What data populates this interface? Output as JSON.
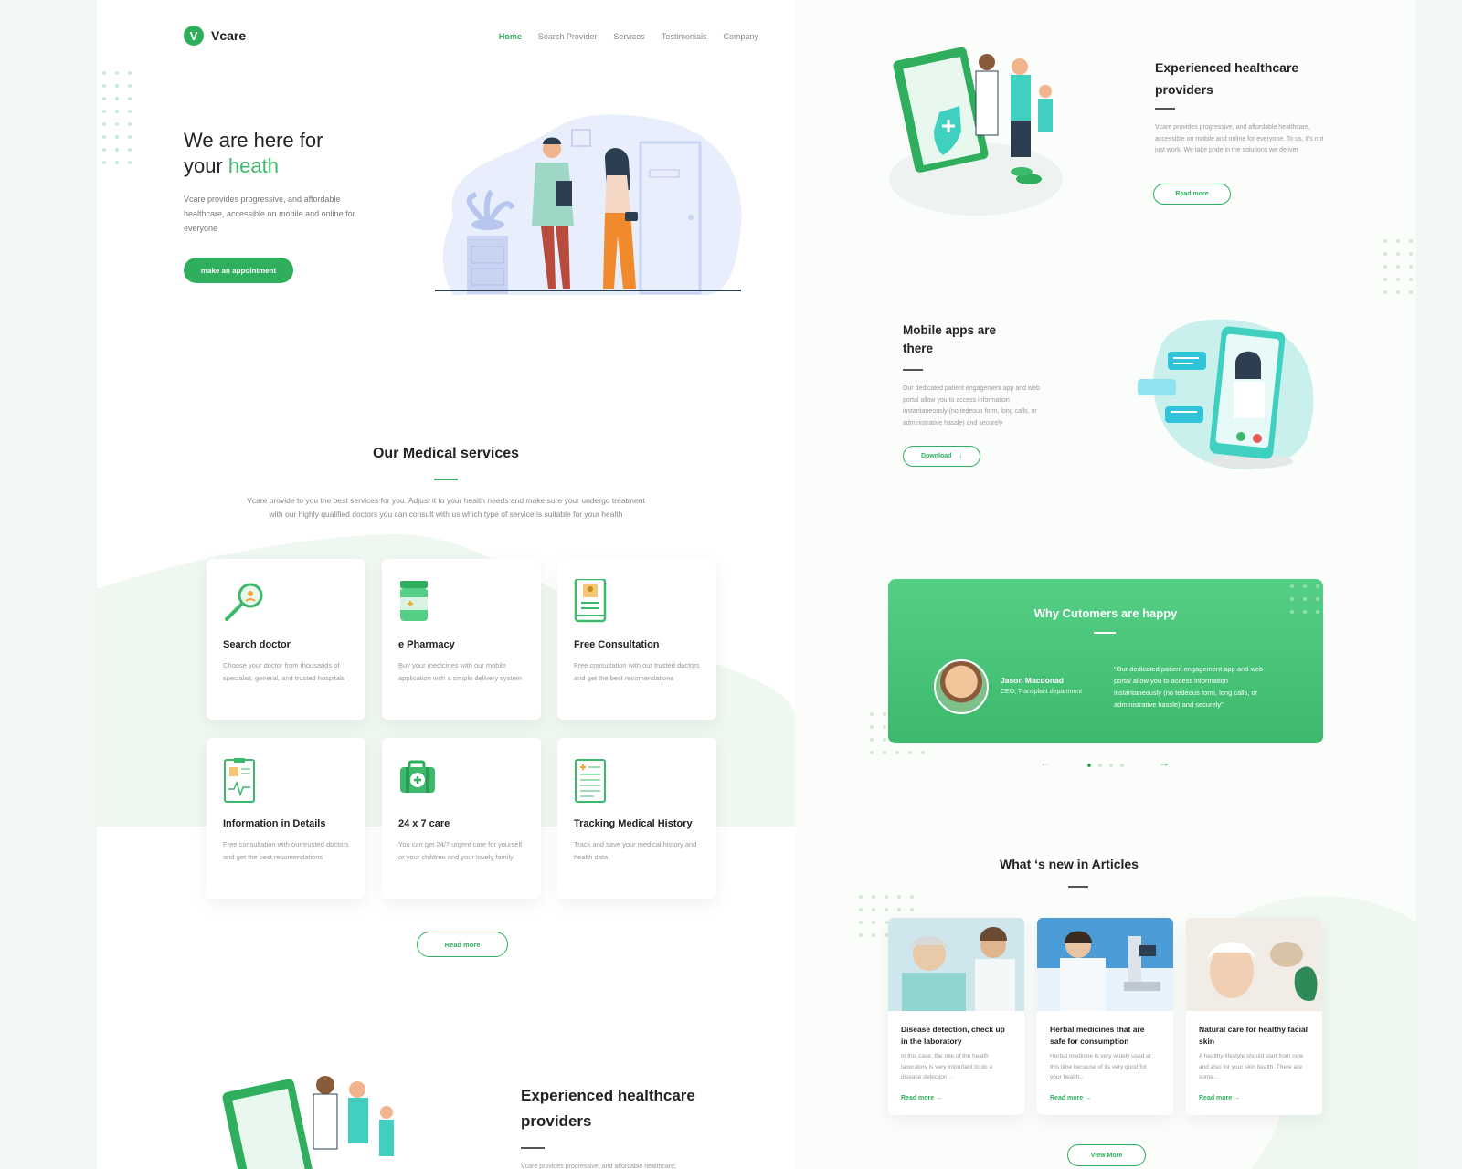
{
  "nav": {
    "logo_letter": "V",
    "logo_text": "Vcare",
    "items": [
      "Home",
      "Search Provider",
      "Services",
      "Testimonials",
      "Company"
    ]
  },
  "hero": {
    "title_line1": "We are here for",
    "title_prefix": "your ",
    "title_highlight": "heath",
    "description": "Vcare provides progressive, and affordable healthcare, accessible on mobile and online for everyone",
    "cta": "make an appointment"
  },
  "services": {
    "title": "Our Medical services",
    "description_line1": "Vcare provide to you the best services for you. Adjust it to your health needs and make sure your undergo treatment",
    "description_line2": "with our highly qualified doctors you can consult with us which type of service is suitable for your health",
    "cards": [
      {
        "icon": "magnifier-icon",
        "title": "Search doctor",
        "desc": "Choose your doctor from thousands of specialist, general, and trusted hospitals"
      },
      {
        "icon": "pill-bottle-icon",
        "title": "e Pharmacy",
        "desc": "Buy  your medicines with our mobile application with a simple delivery system"
      },
      {
        "icon": "consultation-tablet-icon",
        "title": "Free Consultation",
        "desc": "Free consultation with our trusted doctors and get the best recomendations"
      },
      {
        "icon": "clipboard-chart-icon",
        "title": "Information in Details",
        "desc": "Free consultation with our trusted doctors and get the best recomendations"
      },
      {
        "icon": "first-aid-kit-icon",
        "title": "24 x 7 care",
        "desc": "You can get 24/7 urgent care for yourself or your children and your lovely family"
      },
      {
        "icon": "medical-record-icon",
        "title": "Tracking Medical History",
        "desc": "Track and save your medical history and health data"
      }
    ],
    "read_more": "Read more"
  },
  "providers_left": {
    "title_line1": "Experienced healthcare",
    "title_line2": "providers",
    "description": "Vcare provides progressive, and affordable healthcare,"
  },
  "providers_right": {
    "title_line1": "Experienced healthcare",
    "title_line2": "providers",
    "description": "Vcare provides progressive, and affordable healthcare, accessible on mobile and online for everyone. To us, it's not just work. We take pride in the solutions we deliver",
    "read_more": "Read more"
  },
  "mobile": {
    "title_line1": "Mobile apps are",
    "title_line2": "there",
    "description": "Our dedicated patient engagement app and web portal allow you to access information instantaneously (no tedeous form, long calls, or administrative hassle) and securely",
    "download": "Download",
    "download_icon": "↓"
  },
  "testimonial": {
    "title": "Why Cutomers are happy",
    "name": "Jason Macdonad",
    "role": "CEO, Transplant department",
    "quote": "\"Our dedicated patient engagement app and web portal allow you to access information instantaneously (no tedeous form, long calls, or administrative hassle) and securely\"",
    "prev": "←",
    "next": "→"
  },
  "articles": {
    "title": "What ‘s new in Articles",
    "items": [
      {
        "title": "Disease detection, check up in the laboratory",
        "desc": "In this case, the role of the health laboratory is very important to do a disease detection...",
        "link": "Read more  →"
      },
      {
        "title": "Herbal medicines that are safe for consumption",
        "desc": "Herbal medicine is very widely used at this time because of its very good for your health...",
        "link": "Read more  →"
      },
      {
        "title": "Natural care for healthy facial skin",
        "desc": "A healthy lifestyle should start from now and also for your skin health. There are some...",
        "link": "Read more  →"
      }
    ],
    "view_more": "View More"
  },
  "colors": {
    "accent": "#2fae5d",
    "accent_light": "#56cf86"
  }
}
